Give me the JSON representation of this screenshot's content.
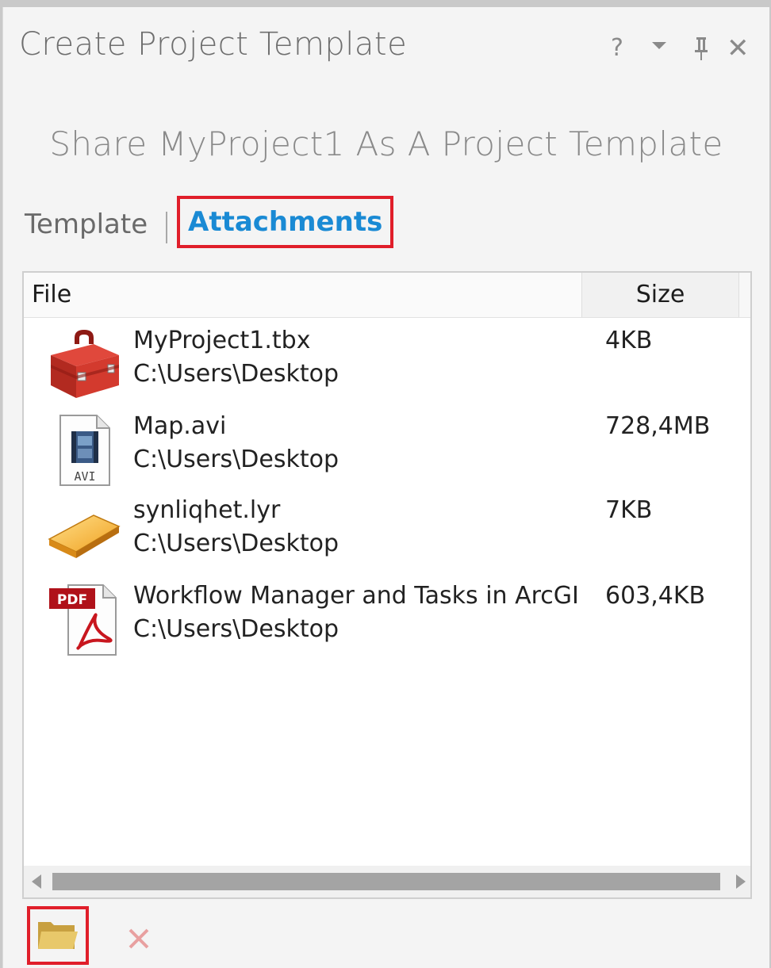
{
  "window": {
    "title": "Create Project Template",
    "help_label": "?",
    "close_label": "✕"
  },
  "subtitle": "Share MyProject1 As A Project Template",
  "tabs": [
    {
      "label": "Template",
      "selected": false
    },
    {
      "label": "Attachments",
      "selected": true
    }
  ],
  "table": {
    "columns": [
      "File",
      "Size"
    ],
    "rows": [
      {
        "icon": "toolbox-icon",
        "name": "MyProject1.tbx",
        "path": "C:\\Users\\Desktop",
        "size": "4KB"
      },
      {
        "icon": "avi-file-icon",
        "name": "Map.avi",
        "path": "C:\\Users\\Desktop",
        "size": "728,4MB"
      },
      {
        "icon": "layer-file-icon",
        "name": "synliqhet.lyr",
        "path": "C:\\Users\\Desktop",
        "size": "7KB"
      },
      {
        "icon": "pdf-file-icon",
        "name": "Workflow Manager and Tasks in ArcGIS",
        "path": "C:\\Users\\Desktop",
        "size": "603,4KB"
      }
    ]
  },
  "toolbar": {
    "add_icon": "open-folder-icon",
    "remove_icon": "remove-icon"
  },
  "colors": {
    "accent": "#1a8ad4",
    "highlight": "#e01e2a"
  }
}
